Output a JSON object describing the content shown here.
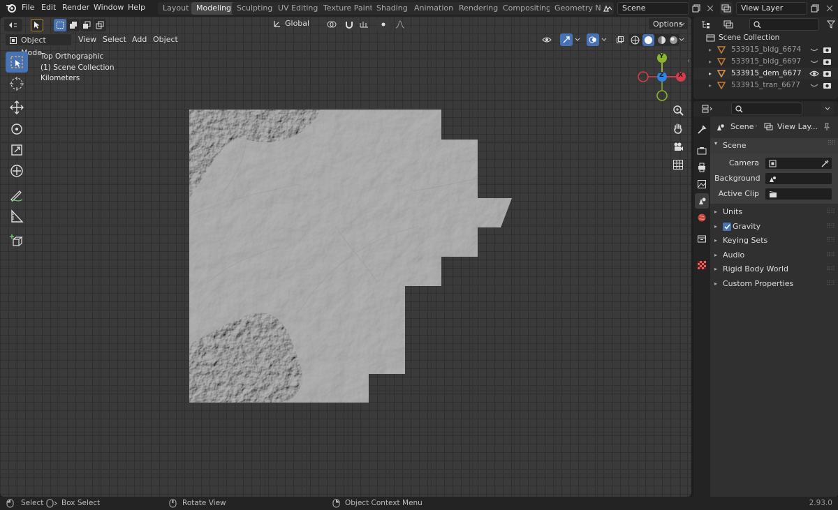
{
  "menubar": {
    "items": [
      "File",
      "Edit",
      "Render",
      "Window",
      "Help"
    ]
  },
  "workspaces": {
    "tabs": [
      "Layout",
      "Modeling",
      "Sculpting",
      "UV Editing",
      "Texture Paint",
      "Shading",
      "Animation",
      "Rendering",
      "Compositing",
      "Geometry N"
    ],
    "active": "Modeling"
  },
  "scene_selector": {
    "value": "Scene"
  },
  "viewlayer_selector": {
    "value": "View Layer"
  },
  "viewport_header": {
    "mode": "Object Mode",
    "menus": [
      "View",
      "Select",
      "Add",
      "Object"
    ],
    "orientation": "Global",
    "options_label": "Options"
  },
  "viewport_overlay": {
    "view_name": "Top Orthographic",
    "collection": "(1) Scene Collection",
    "units": "Kilometers"
  },
  "gizmo": {
    "x": "X",
    "y": "Y",
    "z": "Z"
  },
  "outliner": {
    "root": "Scene Collection",
    "items": [
      {
        "name": "533915_bldg_6674",
        "visible": false
      },
      {
        "name": "533915_bldg_6697",
        "visible": false
      },
      {
        "name": "533915_dem_6677",
        "visible": true
      },
      {
        "name": "533915_tran_6677",
        "visible": false
      }
    ]
  },
  "properties": {
    "breadcrumb_scene": "Scene",
    "breadcrumb_layer": "View Lay...",
    "panel_title": "Scene",
    "camera_label": "Camera",
    "background_label": "Background ...",
    "active_clip_label": "Active Clip",
    "subpanels": [
      "Units",
      "Gravity",
      "Keying Sets",
      "Audio",
      "Rigid Body World",
      "Custom Properties"
    ],
    "gravity_checked": true
  },
  "statusbar": {
    "select": "Select",
    "box_select": "Box Select",
    "rotate": "Rotate View",
    "context_menu": "Object Context Menu",
    "version": "2.93.0"
  },
  "colors": {
    "accent": "#4772b3",
    "axis_x": "#d83b4c",
    "axis_y": "#8bb62c",
    "axis_z": "#2f84e3",
    "terrain": "#a8a8a8",
    "mesh_icon": "#e0944c"
  }
}
